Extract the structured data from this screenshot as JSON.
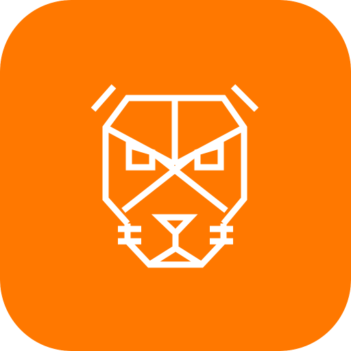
{
  "icon": {
    "name": "geometric-dog-face-icon",
    "background_color": "#FF7800",
    "line_color": "#FFFFFF"
  }
}
